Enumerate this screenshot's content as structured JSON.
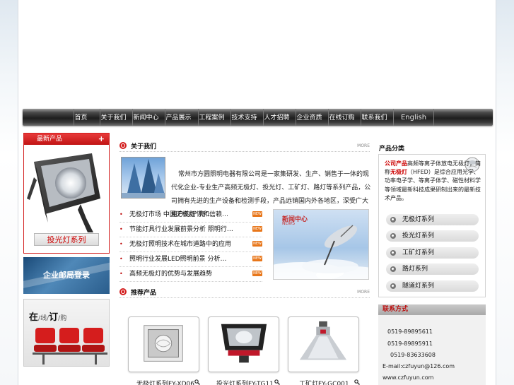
{
  "nav": {
    "items": [
      "首页",
      "关于我们",
      "新闻中心",
      "产品展示",
      "工程案例",
      "技术支持",
      "人才招聘",
      "企业资质",
      "在线订购",
      "联系我们"
    ],
    "english": "English"
  },
  "left": {
    "new_products_title": "最新产品",
    "plus": "+",
    "lamp_button": "投光灯系列",
    "login_banner": "企业邮局登录",
    "order": {
      "c1": "在",
      "c2": "线",
      "c3": "订",
      "c4": "购"
    }
  },
  "about": {
    "title": "关于我们",
    "more": "MORE",
    "text": "常州市方圆照明电器有限公司是一家集研发、生产、销售于一体的现代化企业-专业生产高频无极灯、投光灯、工矿灯、路灯等系列产品，公司拥有先进的生产设备和检测手段，产品远销国内外各地区，深受广大用户的好评和信赖…"
  },
  "news": {
    "items": [
      {
        "text": "无极灯市场 中国无极灯“亮”…",
        "badge": "NEW"
      },
      {
        "text": "节能灯具行业发展前景分析 照明行…",
        "badge": "NEW"
      },
      {
        "text": "无极灯照明技术在城市道路中的应用",
        "badge": "NEW"
      },
      {
        "text": "照明行业发展LED照明前景 分析…",
        "badge": "NEW"
      },
      {
        "text": "高频无极灯的优势与发展趋势",
        "badge": "NEW"
      }
    ],
    "image_label": "新闻中心",
    "image_label2": "NEWS"
  },
  "recommend": {
    "title": "推荐产品",
    "more": "MORE",
    "products": [
      {
        "name": "无极灯系列FY-XD06"
      },
      {
        "name": "投光灯系列FY-TG11"
      },
      {
        "name": "工矿灯FY-GC001"
      }
    ]
  },
  "categories": {
    "title": "产品分类",
    "desc_prefix": "公司产品",
    "desc_1": "高频等离子体放电无极灯，简称",
    "desc_red": "无极灯",
    "desc_2": "（HFED）是综合应用光学、功率电子学、等离子体学、磁性材料学等领域最新科技成果研制出来的最新技术产品。",
    "items": [
      "无极灯系列",
      "投光灯系列",
      "工矿灯系列",
      "路灯系列",
      "隧道灯系列"
    ]
  },
  "contact": {
    "title": "联系方式",
    "phone1": "0519-89895611",
    "phone2": "0519-89895911",
    "phone3": "0519-83633608",
    "email": "E-mail:czfuyun@126.com",
    "web": "www.czfuyun.com"
  },
  "colors": {
    "accent": "#d42020",
    "nav": "#1e1e1e",
    "link_red": "#cc0000"
  }
}
